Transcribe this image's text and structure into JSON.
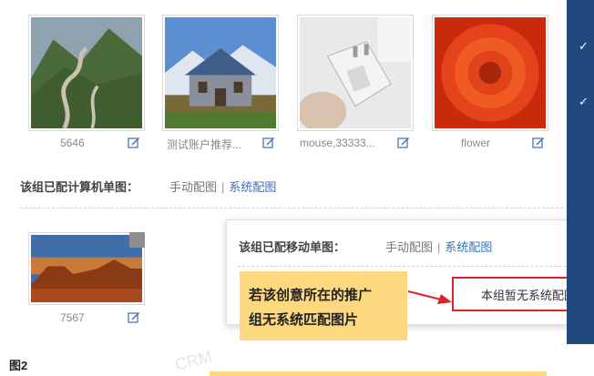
{
  "computer_images": [
    {
      "caption": "5646",
      "image": "mountain-road"
    },
    {
      "caption": "测试账户推荐...",
      "image": "castle"
    },
    {
      "caption": "mouse,33333...",
      "image": "power-adapter"
    },
    {
      "caption": "flower",
      "image": "red-flower"
    }
  ],
  "computer_row": {
    "label": "该组已配计算机单图：",
    "manual_link": "手动配图",
    "separator": "|",
    "system_link": "系统配图"
  },
  "mobile_images": [
    {
      "caption": "7567",
      "image": "desert-mesa"
    }
  ],
  "mobile_popup": {
    "label": "该组已配移动单图：",
    "manual_link": "手动配图",
    "separator": "|",
    "system_link": "系统配图",
    "no_image_message": "本组暂无系统配图"
  },
  "callout": {
    "line1": "若该创意所在的推广",
    "line2": "组无系统匹配图片"
  },
  "figure_label": "图2",
  "watermark": "CRM",
  "colors": {
    "sidebar": "#21497d",
    "callout_bg": "#fcd87e",
    "highlight_border": "#d9242b",
    "system_link": "#3a6fb5",
    "edit_icon": "#3a6fb5"
  }
}
